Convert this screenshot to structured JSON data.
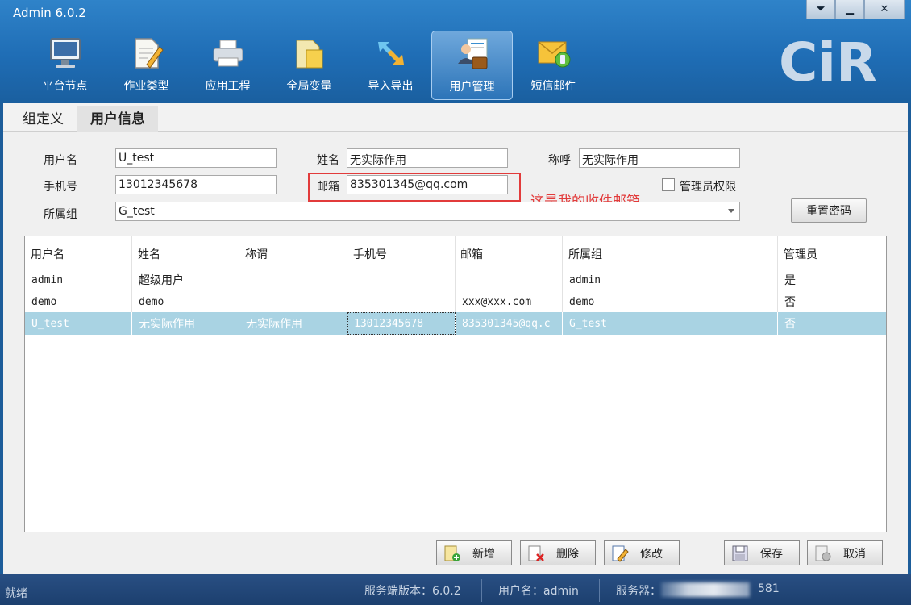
{
  "window": {
    "title": "Admin 6.0.2"
  },
  "toolbar": [
    {
      "label": "平台节点",
      "icon": "monitor-icon"
    },
    {
      "label": "作业类型",
      "icon": "document-pencil-icon"
    },
    {
      "label": "应用工程",
      "icon": "printer-icon"
    },
    {
      "label": "全局变量",
      "icon": "folder-document-icon"
    },
    {
      "label": "导入导出",
      "icon": "arrows-icon"
    },
    {
      "label": "用户管理",
      "icon": "user-briefcase-icon"
    },
    {
      "label": "短信邮件",
      "icon": "envelope-phone-icon"
    }
  ],
  "logo": {
    "text": "CiR"
  },
  "tabs": [
    "组定义",
    "用户信息"
  ],
  "form": {
    "username_label": "用户名",
    "username": "U_test",
    "name_label": "姓名",
    "name": "无实际作用",
    "title_label": "称呼",
    "title": "无实际作用",
    "phone_label": "手机号",
    "phone": "13012345678",
    "email_label": "邮箱",
    "email": "835301345@qq.com",
    "admin_label": "管理员权限",
    "group_label": "所属组",
    "group": "G_test",
    "reset_password": "重置密码",
    "annotation": "这是我的收件邮箱"
  },
  "table": {
    "headers": [
      "用户名",
      "姓名",
      "称谓",
      "手机号",
      "邮箱",
      "所属组",
      "管理员"
    ],
    "rows": [
      [
        "admin",
        "超级用户",
        "",
        "",
        "",
        "admin",
        "是"
      ],
      [
        "demo",
        "demo",
        "",
        "",
        "xxx@xxx.com",
        "demo",
        "否"
      ],
      [
        "U_test",
        "无实际作用",
        "无实际作用",
        "13012345678",
        "835301345@qq.c",
        "G_test",
        "否"
      ]
    ]
  },
  "buttons": {
    "add": "新增",
    "delete": "删除",
    "edit": "修改",
    "save": "保存",
    "cancel": "取消"
  },
  "status": {
    "ready": "就绪",
    "server_version": "服务端版本：6.0.2",
    "user": "用户名：admin",
    "server_prefix": "服务器：",
    "server_suffix": "581"
  }
}
